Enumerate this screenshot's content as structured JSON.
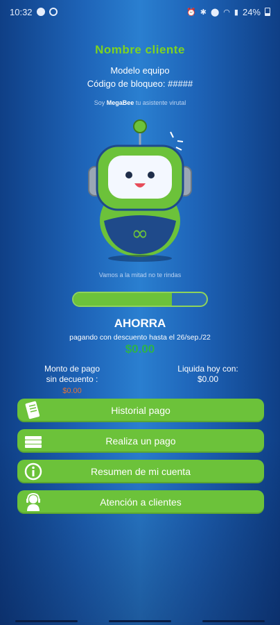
{
  "status_bar": {
    "time": "10:32",
    "battery": "24%"
  },
  "header": {
    "client_name": "Nombre cliente",
    "model": "Modelo equipo",
    "lock_code": "Código de bloqueo: #####"
  },
  "assistant": {
    "prefix": "Soy",
    "name": "MegaBee",
    "suffix": "tu asistente virutal"
  },
  "encouragement": "Vamos a la mitad no te rindas",
  "progress": {
    "value": 0.74
  },
  "savings": {
    "title": "AHORRA",
    "subtitle": "pagando con descuento hasta el  26/sep./22",
    "amount": "$0.00"
  },
  "payment_without_discount": {
    "label_line1": "Monto de pago",
    "label_line2": "sin decuento :",
    "amount": "$0.00"
  },
  "pay_today": {
    "label": "Liquida hoy con:",
    "amount": "$0.00"
  },
  "menu": [
    {
      "label": "Historial pago",
      "icon": "receipt-icon"
    },
    {
      "label": "Realiza un pago",
      "icon": "cash-icon"
    },
    {
      "label": "Resumen de mi cuenta",
      "icon": "info-icon"
    },
    {
      "label": "Atención a clientes",
      "icon": "headset-agent-icon"
    }
  ],
  "colors": {
    "accent_green": "#6cc23a",
    "title_green": "#7ed321",
    "amount_green": "#2bb24c",
    "amount_orange": "#e0753a"
  }
}
